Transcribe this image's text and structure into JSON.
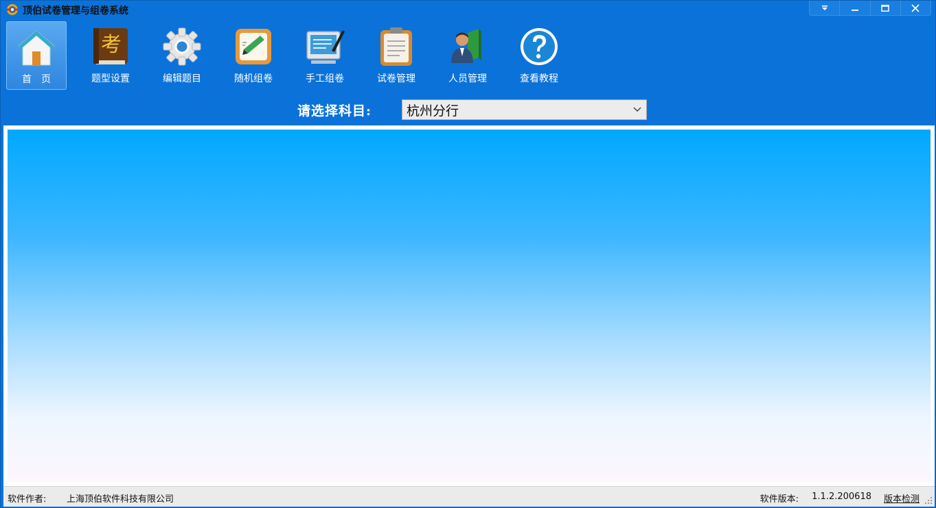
{
  "window": {
    "title": "顶伯试卷管理与组卷系统"
  },
  "toolbar": {
    "items": [
      {
        "label": "首　页",
        "icon": "home-icon",
        "active": true
      },
      {
        "label": "题型设置",
        "icon": "exam-book-icon"
      },
      {
        "label": "编辑题目",
        "icon": "gear-icon"
      },
      {
        "label": "随机组卷",
        "icon": "pencil-paper-icon"
      },
      {
        "label": "手工组卷",
        "icon": "monitor-pen-icon"
      },
      {
        "label": "试卷管理",
        "icon": "clipboard-icon"
      },
      {
        "label": "人员管理",
        "icon": "user-book-icon"
      },
      {
        "label": "查看教程",
        "icon": "help-icon"
      }
    ]
  },
  "subject": {
    "label": "请选择科目:",
    "value": "杭州分行"
  },
  "status": {
    "author_label": "软件作者:",
    "author": "上海顶伯软件科技有限公司",
    "version_label": "软件版本:",
    "version": "1.1.2.200618",
    "check_label": "版本检测"
  }
}
